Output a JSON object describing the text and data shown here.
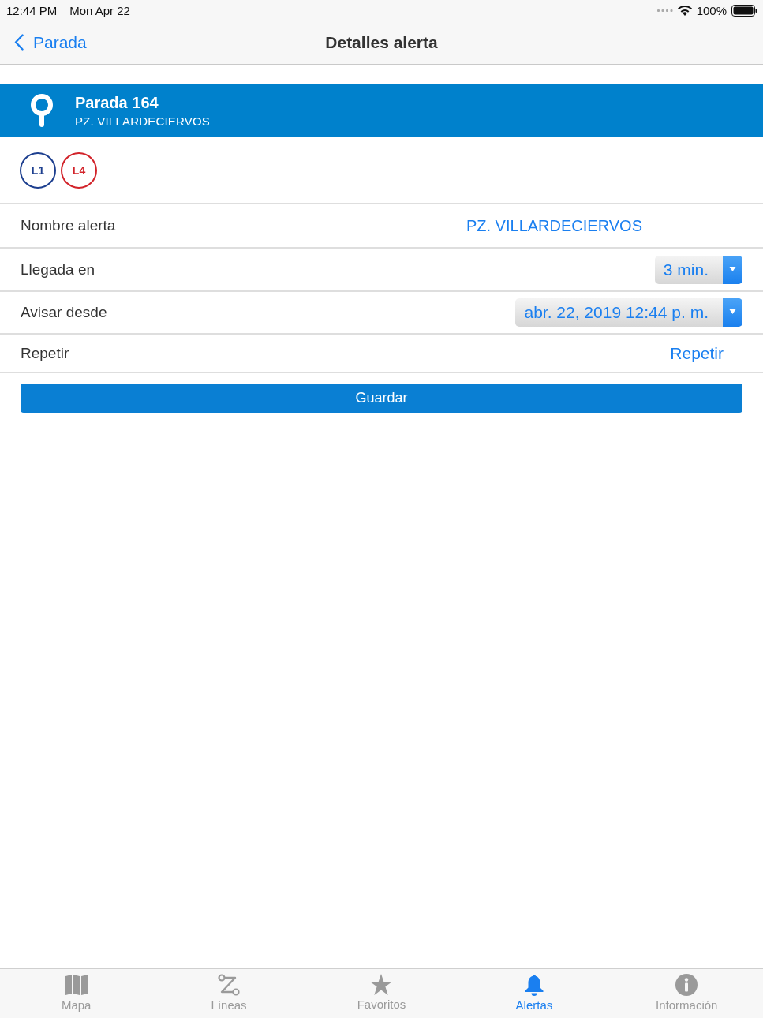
{
  "status_bar": {
    "time": "12:44 PM",
    "date": "Mon Apr 22",
    "battery": "100%"
  },
  "nav": {
    "back": "Parada",
    "title": "Detalles alerta"
  },
  "stop": {
    "name": "Parada 164",
    "subtitle": "PZ. VILLARDECIERVOS"
  },
  "lines": [
    {
      "label": "L1",
      "color": "#1d3f8f"
    },
    {
      "label": "L4",
      "color": "#d2232a"
    }
  ],
  "fields": [
    {
      "kind": "text",
      "label": "Nombre alerta",
      "value": "PZ. VILLARDECIERVOS"
    },
    {
      "kind": "select",
      "label": "Llegada en",
      "value": "3 min."
    },
    {
      "kind": "select",
      "label": "Avisar desde",
      "value": "abr. 22, 2019 12:44 p. m."
    },
    {
      "kind": "link",
      "label": "Repetir",
      "value": "Repetir"
    }
  ],
  "save_button": "Guardar",
  "tabs": [
    {
      "label": "Mapa",
      "selected": false
    },
    {
      "label": "Líneas",
      "selected": false
    },
    {
      "label": "Favoritos",
      "selected": false
    },
    {
      "label": "Alertas",
      "selected": true
    },
    {
      "label": "Información",
      "selected": false
    }
  ]
}
